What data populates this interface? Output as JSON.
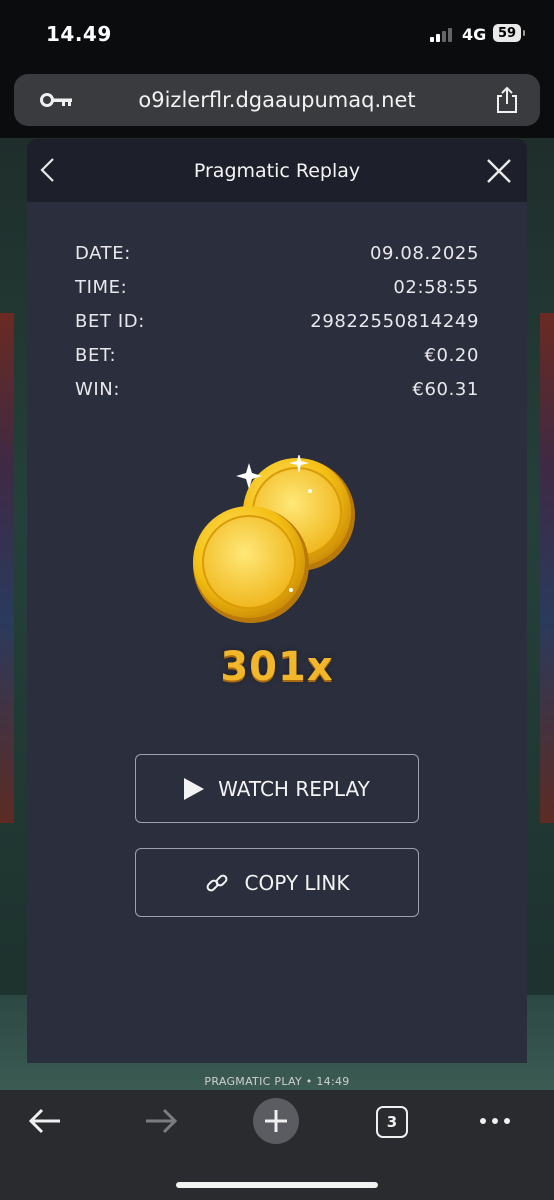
{
  "status_bar": {
    "time": "14.49",
    "network": "4G",
    "battery": "59"
  },
  "browser": {
    "url": "o9izlerflr.dgaaupumaq.net"
  },
  "modal": {
    "title": "Pragmatic Replay",
    "details": [
      {
        "label": "DATE:",
        "value": "09.08.2025"
      },
      {
        "label": "TIME:",
        "value": "02:58:55"
      },
      {
        "label": "BET ID:",
        "value": "29822550814249"
      },
      {
        "label": "BET:",
        "value": "€0.20"
      },
      {
        "label": "WIN:",
        "value": "€60.31"
      }
    ],
    "multiplier": "301x",
    "watch_replay_label": "WATCH REPLAY",
    "copy_link_label": "COPY LINK",
    "accent_color": "#f2b62a"
  },
  "game": {
    "footer": "PRAGMATIC PLAY • 14:49"
  },
  "bottom_nav": {
    "tab_count": "3"
  },
  "icons": [
    "key-icon",
    "share-icon",
    "back-icon",
    "close-icon",
    "coins-icon",
    "play-icon",
    "link-icon",
    "arrow-left-icon",
    "arrow-right-icon",
    "plus-icon",
    "tabs-icon",
    "more-icon"
  ]
}
